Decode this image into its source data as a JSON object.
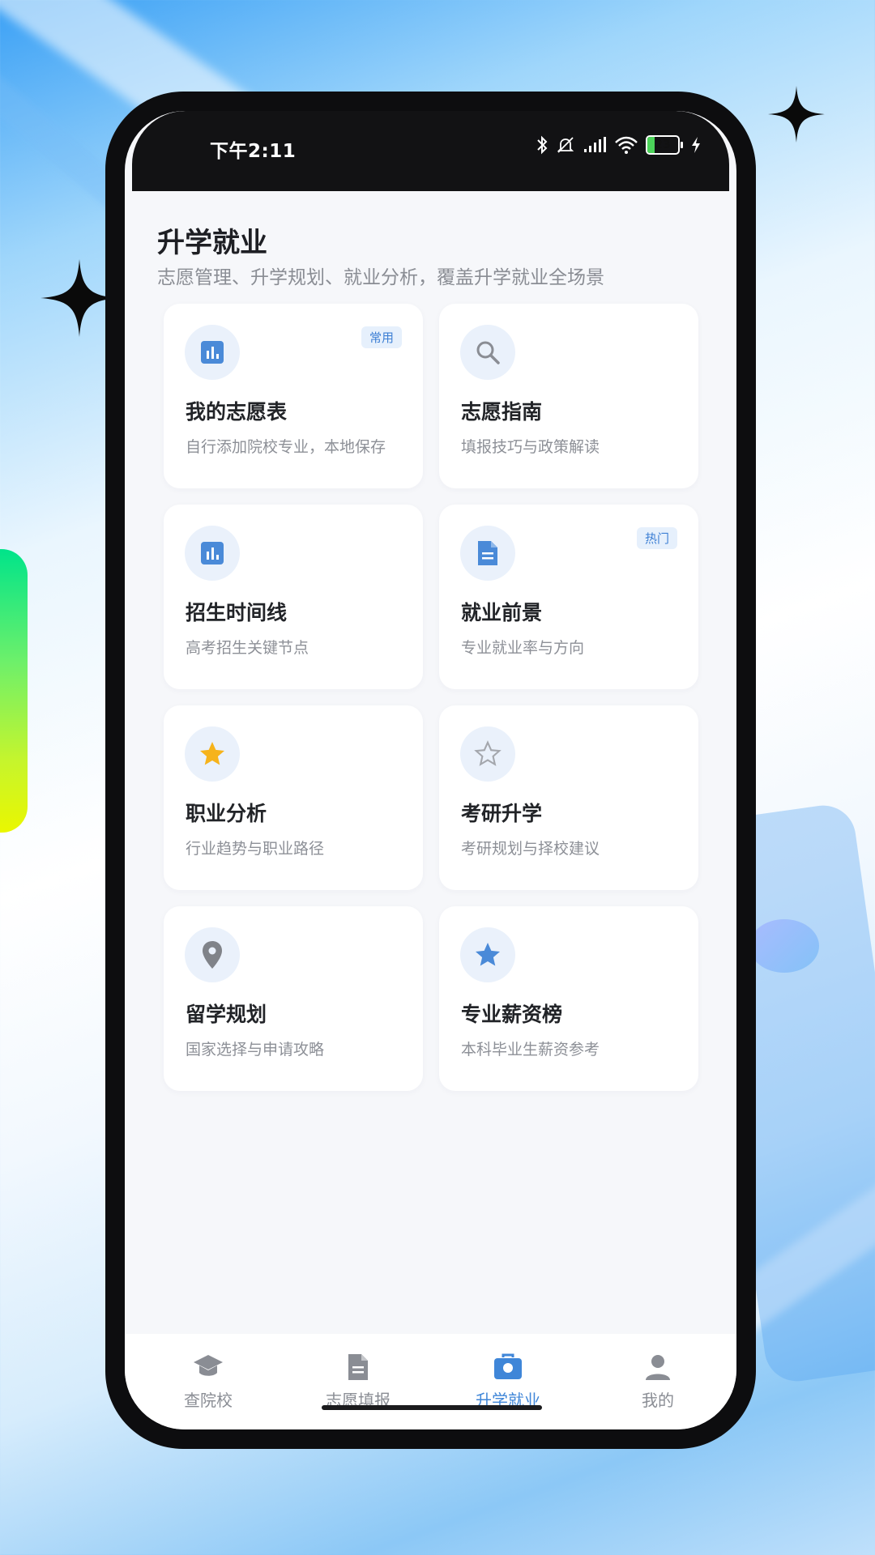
{
  "status_bar": {
    "time": "下午2:11",
    "battery_level": "23",
    "icons": [
      "bluetooth-icon",
      "bell-muted-icon",
      "signal-icon",
      "wifi-icon",
      "battery-icon",
      "charging-icon"
    ]
  },
  "header": {
    "title": "升学就业",
    "subtitle": "志愿管理、升学规划、就业分析，覆盖升学就业全场景"
  },
  "cards": [
    {
      "title": "我的志愿表",
      "desc": "自行添加院校专业，本地保存",
      "badge": "常用",
      "icon": "bar-chart-icon"
    },
    {
      "title": "志愿指南",
      "desc": "填报技巧与政策解读",
      "badge": "",
      "icon": "search-icon"
    },
    {
      "title": "招生时间线",
      "desc": "高考招生关键节点",
      "badge": "",
      "icon": "bar-chart-icon"
    },
    {
      "title": "就业前景",
      "desc": "专业就业率与方向",
      "badge": "热门",
      "icon": "document-icon"
    },
    {
      "title": "职业分析",
      "desc": "行业趋势与职业路径",
      "badge": "",
      "icon": "star-filled-icon"
    },
    {
      "title": "考研升学",
      "desc": "考研规划与择校建议",
      "badge": "",
      "icon": "star-outline-icon"
    },
    {
      "title": "留学规划",
      "desc": "国家选择与申请攻略",
      "badge": "",
      "icon": "location-pin-icon"
    },
    {
      "title": "专业薪资榜",
      "desc": "本科毕业生薪资参考",
      "badge": "",
      "icon": "star-filled-icon"
    }
  ],
  "tabs": [
    {
      "label": "查院校",
      "icon": "graduation-cap-icon",
      "active": false
    },
    {
      "label": "志愿填报",
      "icon": "document-icon",
      "active": false
    },
    {
      "label": "升学就业",
      "icon": "briefcase-icon",
      "active": true
    },
    {
      "label": "我的",
      "icon": "person-icon",
      "active": false
    }
  ],
  "colors": {
    "accent": "#3f86d8",
    "star_gold": "#f6b31b",
    "badge_bg": "#e6f0fc",
    "icon_bg": "#eaf1fb"
  }
}
